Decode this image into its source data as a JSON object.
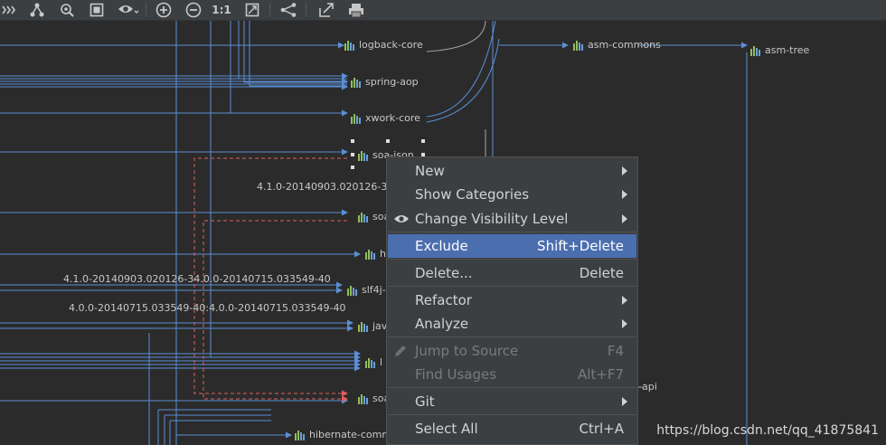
{
  "toolbar": {
    "zoom_actual_label": "1:1"
  },
  "nodes": [
    {
      "id": "logback",
      "label": "logback-core"
    },
    {
      "id": "springaop",
      "label": "spring-aop"
    },
    {
      "id": "xwork",
      "label": "xwork-core"
    },
    {
      "id": "soajson",
      "label": "soa-json"
    },
    {
      "id": "soa2",
      "label": "soa"
    },
    {
      "id": "h",
      "label": "h"
    },
    {
      "id": "slf4j",
      "label": "slf4j-"
    },
    {
      "id": "jav",
      "label": "jav"
    },
    {
      "id": "l",
      "label": "l"
    },
    {
      "id": "soa3",
      "label": "soa"
    },
    {
      "id": "hibernate",
      "label": "hibernate-comm"
    },
    {
      "id": "asmcommons",
      "label": "asm-commons"
    },
    {
      "id": "asmtree",
      "label": "asm-tree"
    },
    {
      "id": "api",
      "label": "-api"
    }
  ],
  "edge_labels": {
    "e1": "4.1.0-20140903.020126-3",
    "e2": "4.1.0-20140903.020126-34.0.0-20140715.033549-40",
    "e3": "4.0.0-20140715.033549-40:4.0.0-20140715.033549-40"
  },
  "context_menu": {
    "items": [
      {
        "label": "New",
        "shortcut": "",
        "submenu": true
      },
      {
        "label": "Show Categories",
        "shortcut": "",
        "submenu": true
      },
      {
        "label": "Change Visibility Level",
        "shortcut": "",
        "submenu": true
      },
      {
        "label": "Exclude",
        "shortcut": "Shift+Delete",
        "submenu": false
      },
      {
        "label": "Delete...",
        "shortcut": "Delete",
        "submenu": false
      },
      {
        "label": "Refactor",
        "shortcut": "",
        "submenu": true
      },
      {
        "label": "Analyze",
        "shortcut": "",
        "submenu": true
      },
      {
        "label": "Jump to Source",
        "shortcut": "F4",
        "submenu": false
      },
      {
        "label": "Find Usages",
        "shortcut": "Alt+F7",
        "submenu": false
      },
      {
        "label": "Git",
        "shortcut": "",
        "submenu": true
      },
      {
        "label": "Select All",
        "shortcut": "Ctrl+A",
        "submenu": false
      }
    ],
    "highlighted": "Exclude",
    "disabled": [
      "Jump to Source",
      "Find Usages"
    ]
  },
  "watermark": "https://blog.csdn.net/qq_41875841",
  "colors": {
    "canvas": "#2b2b2b",
    "toolbar": "#3c3f41",
    "edge": "#5b8fd6",
    "conflict_edge": "#e0605a",
    "selection": "#4b6eaf"
  },
  "icons": [
    "collapse-icon",
    "tree-layout-icon",
    "locate-icon",
    "fit-content-icon",
    "eye-icon",
    "zoom-in-icon",
    "zoom-out-icon",
    "actual-size-icon",
    "fit-page-icon",
    "share-icon",
    "export-icon",
    "print-icon"
  ]
}
